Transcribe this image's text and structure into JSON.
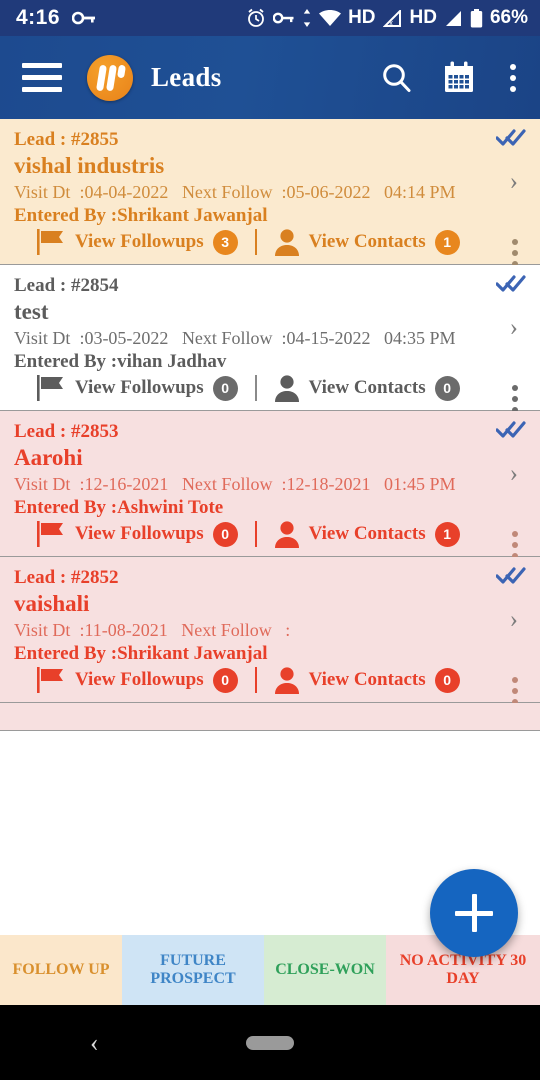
{
  "status_bar": {
    "time": "4:16",
    "battery_percent": "66%",
    "icons": [
      "key-icon",
      "alarm-icon",
      "vpn-key-icon",
      "data-transfer-icon",
      "wifi-icon",
      "hd-label",
      "signal-off-icon",
      "hd-label-2",
      "signal-icon",
      "battery-icon"
    ],
    "hd_label": "HD",
    "background": "#203a7a"
  },
  "app_bar": {
    "title": "Leads",
    "menu_icon": "hamburger-menu-icon",
    "logo_icon": "app-logo-icon",
    "search_icon": "search-icon",
    "calendar_icon": "calendar-icon",
    "overflow_icon": "more-vertical-icon",
    "background": "#1f5095"
  },
  "leads": [
    {
      "theme": "cream",
      "id_label": "Lead : #2855",
      "name": "vishal industris",
      "visit_label": "Visit Dt",
      "visit_date": ":04-04-2022",
      "next_label": "Next Follow",
      "next_date": ":05-06-2022",
      "next_time": "04:14 PM",
      "entered_by": "Entered By :Shrikant Jawanjal",
      "followups_label": "View Followups",
      "followups_count": "3",
      "contacts_label": "View Contacts",
      "contacts_count": "1",
      "flag_icon": "flag-icon",
      "person_icon": "person-icon",
      "read_icon": "double-check-icon",
      "chevron_icon": "chevron-right-icon",
      "kebab_icon": "more-vertical-icon",
      "accent": "#d98020"
    },
    {
      "theme": "plain",
      "id_label": "Lead : #2854",
      "name": "test",
      "visit_label": "Visit Dt",
      "visit_date": ":03-05-2022",
      "next_label": "Next Follow",
      "next_date": ":04-15-2022",
      "next_time": "04:35 PM",
      "entered_by": "Entered By :vihan Jadhav",
      "followups_label": "View Followups",
      "followups_count": "0",
      "contacts_label": "View Contacts",
      "contacts_count": "0",
      "flag_icon": "flag-icon",
      "person_icon": "person-icon",
      "read_icon": "double-check-icon",
      "chevron_icon": "chevron-right-icon",
      "kebab_icon": "more-vertical-icon",
      "accent": "#5c5c5c"
    },
    {
      "theme": "pink",
      "id_label": "Lead : #2853",
      "name": "Aarohi",
      "visit_label": "Visit Dt",
      "visit_date": ":12-16-2021",
      "next_label": "Next Follow",
      "next_date": ":12-18-2021",
      "next_time": "01:45 PM",
      "entered_by": "Entered By :Ashwini Tote",
      "followups_label": "View Followups",
      "followups_count": "0",
      "contacts_label": "View Contacts",
      "contacts_count": "1",
      "flag_icon": "flag-icon",
      "person_icon": "person-icon",
      "read_icon": "double-check-icon",
      "chevron_icon": "chevron-right-icon",
      "kebab_icon": "more-vertical-icon",
      "accent": "#e8402a"
    },
    {
      "theme": "pink",
      "id_label": "Lead : #2852",
      "name": "vaishali",
      "visit_label": "Visit Dt",
      "visit_date": ":11-08-2021",
      "next_label": "Next Follow",
      "next_date": ":",
      "next_time": "",
      "entered_by": "Entered By :Shrikant Jawanjal",
      "followups_label": "View Followups",
      "followups_count": "0",
      "contacts_label": "View Contacts",
      "contacts_count": "0",
      "flag_icon": "flag-icon",
      "person_icon": "person-icon",
      "read_icon": "double-check-icon",
      "chevron_icon": "chevron-right-icon",
      "kebab_icon": "more-vertical-icon",
      "accent": "#e8402a"
    }
  ],
  "fab": {
    "icon": "plus-icon",
    "color": "#1565c0"
  },
  "bottom_tabs": [
    {
      "label": "FOLLOW UP",
      "bg": "#fbe7cb",
      "color": "#d9902e"
    },
    {
      "label": "FUTURE PROSPECT",
      "bg": "#cfe4f5",
      "color": "#3f85c6"
    },
    {
      "label": "CLOSE-WON",
      "bg": "#d6ecd2",
      "color": "#2fa05a"
    },
    {
      "label": "NO ACTIVITY 30 DAY",
      "bg": "#f6dcdc",
      "color": "#e8402a"
    }
  ],
  "nav_bar": {
    "back_icon": "back-chevron-icon",
    "home_icon": "home-pill-icon"
  }
}
